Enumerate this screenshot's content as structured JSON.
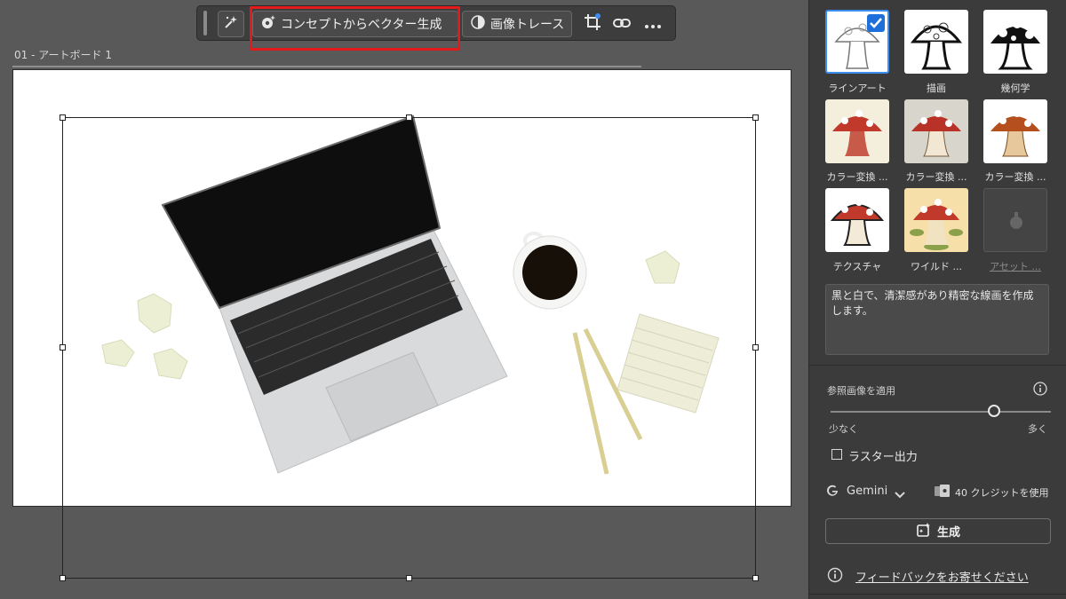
{
  "toolbar": {
    "magic_icon": "sparkle-wand-icon",
    "concept_to_vector_label": "コンセプトからベクター生成",
    "image_trace_label": "画像トレース",
    "crop_icon": "crop-icon",
    "link_icon": "link-icon",
    "more_icon": "more-horizontal-icon"
  },
  "artboard": {
    "label": "01 - アートボード 1"
  },
  "panel": {
    "styles": [
      {
        "label": "ラインアート",
        "selected": true
      },
      {
        "label": "描画",
        "selected": false
      },
      {
        "label": "幾何学",
        "selected": false
      },
      {
        "label": "カラー変換 ...",
        "selected": false
      },
      {
        "label": "カラー変換 ...",
        "selected": false
      },
      {
        "label": "カラー変換 ...",
        "selected": false
      },
      {
        "label": "テクスチャ",
        "selected": false
      },
      {
        "label": "ワイルド ...",
        "selected": false
      },
      {
        "label": "アセット ...",
        "selected": false
      }
    ],
    "prompt_text": "黒と白で、清潔感があり精密な線画を作成します。",
    "reference_label": "参照画像を適用",
    "slider": {
      "min_label": "少なく",
      "max_label": "多く",
      "value": 0.74
    },
    "raster_output_label": "ラスター出力",
    "raster_output_checked": false,
    "model_label": "Gemini",
    "credits_label": "40 クレジットを使用",
    "generate_label": "生成",
    "feedback_label": "フィードバックをお寄せください"
  },
  "colors": {
    "accent": "#1e6fd9",
    "highlight": "#e3191b",
    "canvas_bg": "#595959",
    "panel_bg": "#3b3b3b"
  }
}
